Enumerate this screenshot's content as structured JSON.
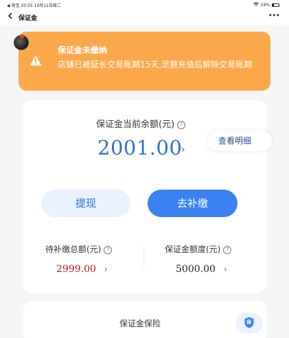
{
  "status_bar": {
    "left": "◀ 淘宝  20:55  10月11日周二",
    "right": "19%"
  },
  "nav": {
    "back_icon": "chevron-left-icon",
    "title": "保证金",
    "more_icon": "more-icon"
  },
  "warning": {
    "title": "保证金未缴纳",
    "text": "店铺已被延长交易账期15天,足额充值后解除交易账期",
    "icon": "warning-triangle-icon",
    "color": "#fba94b"
  },
  "balance": {
    "label": "保证金当前余额(元)",
    "amount": "2001.00",
    "detail_label": "查看明细",
    "accent": "#2f6fd0"
  },
  "actions": {
    "withdraw_label": "提现",
    "topup_label": "去补缴"
  },
  "stats": {
    "pending": {
      "label": "待补缴总额(元)",
      "value": "2999.00",
      "color": "#c0121c"
    },
    "quota": {
      "label": "保证金额度(元)",
      "value": "5000.00",
      "color": "#222222"
    }
  },
  "insurance": {
    "title": "保证金保险",
    "badge_text": "保"
  }
}
